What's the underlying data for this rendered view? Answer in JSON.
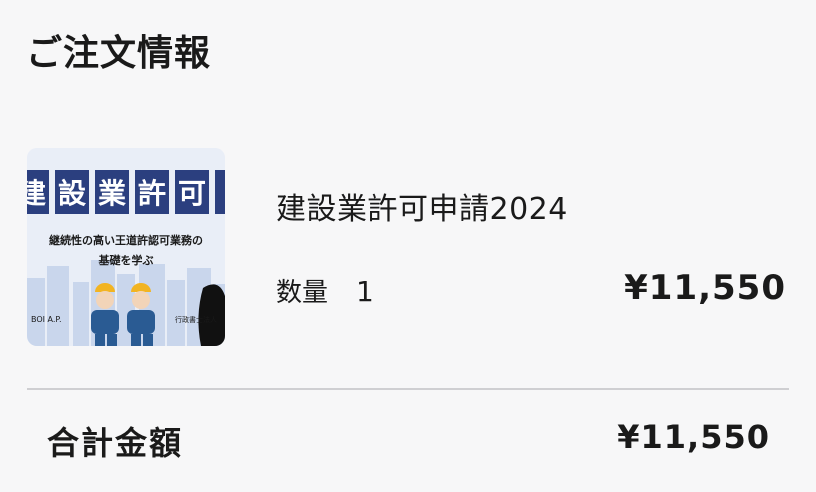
{
  "order": {
    "title": "ご注文情報",
    "item": {
      "name": "建設業許可申請2024",
      "quantity_label": "数量",
      "quantity_value": "1",
      "price": "¥11,550",
      "thumbnail": {
        "banner_chars": [
          "建",
          "設",
          "業",
          "許",
          "可"
        ],
        "line1": "継続性の高い王道許認可業務の",
        "line2": "基礎を学ぶ",
        "footer_left": "BOI A.P.",
        "footer_right": "行政書士法人",
        "colors": {
          "banner_bg": "#2b3f7f",
          "banner_text": "#ffffff",
          "body_bg": "#e9eef7",
          "building": "#c9d6ec",
          "worker_shirt": "#2a5b93",
          "helmet": "#f2b422"
        }
      }
    },
    "total": {
      "label": "合計金額",
      "value": "¥11,550"
    }
  }
}
